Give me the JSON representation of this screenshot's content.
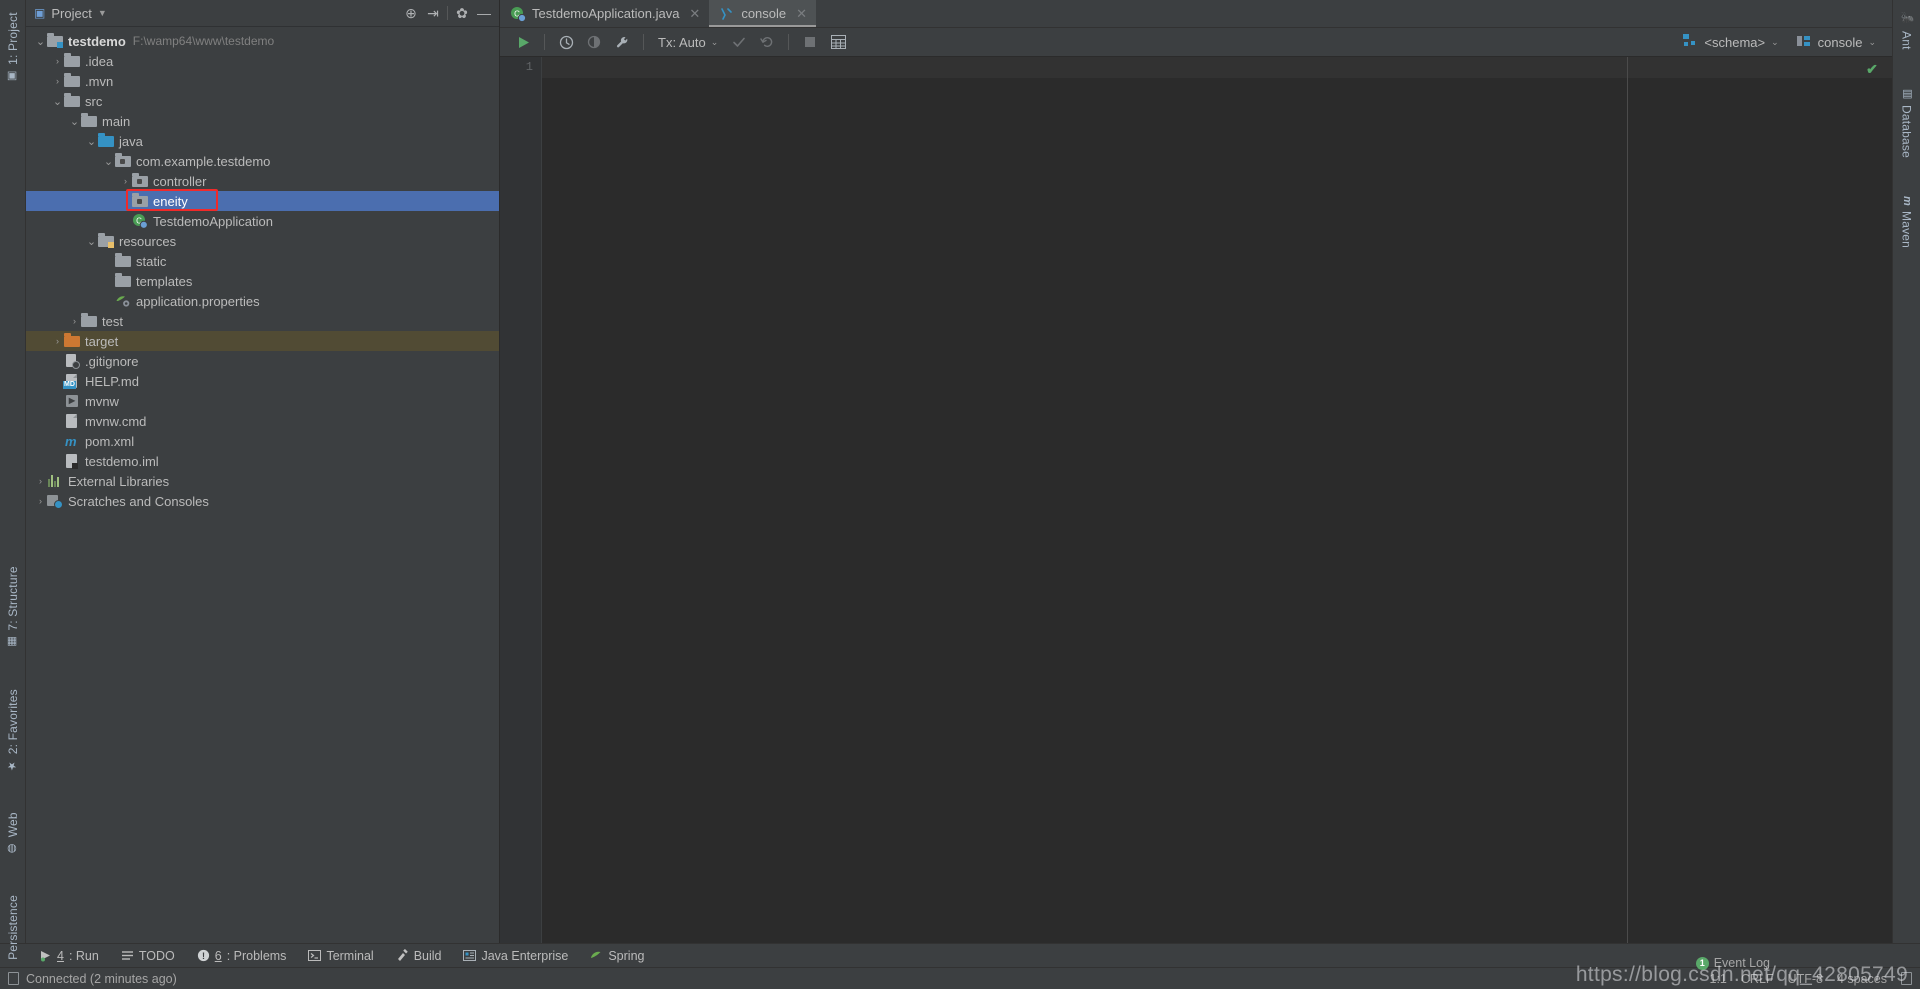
{
  "window": {
    "accent_blue": "#4b6eaf",
    "excluded_olive": "#514b34",
    "annotation_red": "#f02a2a"
  },
  "left_toolbar": {
    "items": [
      {
        "label": "1: Project",
        "icon": "project-icon"
      }
    ]
  },
  "left_sidebar_bottom": {
    "items": [
      {
        "label": "7: Structure",
        "icon": "structure-icon"
      },
      {
        "label": "2: Favorites",
        "icon": "star-icon"
      },
      {
        "label": "Web",
        "icon": "globe-icon"
      },
      {
        "label": "Persistence",
        "icon": "persistence-icon"
      }
    ]
  },
  "right_sidebar": {
    "items": [
      {
        "label": "Ant",
        "icon": "ant-icon"
      },
      {
        "label": "Database",
        "icon": "database-icon"
      },
      {
        "label": "Maven",
        "icon": "maven-icon"
      }
    ]
  },
  "project_panel": {
    "title": "Project",
    "title_chevron": "▼",
    "toolbar_icons": [
      {
        "name": "locate-icon",
        "glyph": "⊕"
      },
      {
        "name": "collapse-all-icon",
        "glyph": "⇥"
      },
      {
        "name": "gear-icon",
        "glyph": "✿"
      },
      {
        "name": "hide-icon",
        "glyph": "—"
      }
    ],
    "tree": [
      {
        "id": "testdemo",
        "label": "testdemo",
        "path": "F:\\wamp64\\www\\testdemo",
        "depth": 0,
        "arrow": "down",
        "icon": "module-folder",
        "bold": true
      },
      {
        "id": "idea",
        "label": ".idea",
        "depth": 1,
        "arrow": "right",
        "icon": "folder"
      },
      {
        "id": "mvn",
        "label": ".mvn",
        "depth": 1,
        "arrow": "right",
        "icon": "folder"
      },
      {
        "id": "src",
        "label": "src",
        "depth": 1,
        "arrow": "down",
        "icon": "folder"
      },
      {
        "id": "main",
        "label": "main",
        "depth": 2,
        "arrow": "down",
        "icon": "folder"
      },
      {
        "id": "java",
        "label": "java",
        "depth": 3,
        "arrow": "down",
        "icon": "source-folder"
      },
      {
        "id": "com.example.testdemo",
        "label": "com.example.testdemo",
        "depth": 4,
        "arrow": "down",
        "icon": "package"
      },
      {
        "id": "controller",
        "label": "controller",
        "depth": 5,
        "arrow": "right",
        "icon": "package"
      },
      {
        "id": "eneity",
        "label": "eneity",
        "depth": 5,
        "arrow": "none",
        "icon": "package",
        "selected": true,
        "annotated": true
      },
      {
        "id": "TestdemoApplication",
        "label": "TestdemoApplication",
        "depth": 5,
        "arrow": "none",
        "icon": "spring-class"
      },
      {
        "id": "resources",
        "label": "resources",
        "depth": 3,
        "arrow": "down",
        "icon": "resource-folder"
      },
      {
        "id": "static",
        "label": "static",
        "depth": 4,
        "arrow": "none",
        "icon": "folder"
      },
      {
        "id": "templates",
        "label": "templates",
        "depth": 4,
        "arrow": "none",
        "icon": "folder"
      },
      {
        "id": "application.properties",
        "label": "application.properties",
        "depth": 4,
        "arrow": "none",
        "icon": "spring-properties"
      },
      {
        "id": "test",
        "label": "test",
        "depth": 2,
        "arrow": "right",
        "icon": "folder"
      },
      {
        "id": "target",
        "label": "target",
        "depth": 1,
        "arrow": "right",
        "icon": "excluded-folder",
        "excluded": true
      },
      {
        "id": ".gitignore",
        "label": ".gitignore",
        "depth": 1,
        "arrow": "none",
        "icon": "gitignore-file"
      },
      {
        "id": "HELP.md",
        "label": "HELP.md",
        "depth": 1,
        "arrow": "none",
        "icon": "markdown-file"
      },
      {
        "id": "mvnw",
        "label": "mvnw",
        "depth": 1,
        "arrow": "none",
        "icon": "script-file"
      },
      {
        "id": "mvnw.cmd",
        "label": "mvnw.cmd",
        "depth": 1,
        "arrow": "none",
        "icon": "cmd-file"
      },
      {
        "id": "pom.xml",
        "label": "pom.xml",
        "depth": 1,
        "arrow": "none",
        "icon": "maven-pom-file"
      },
      {
        "id": "testdemo.iml",
        "label": "testdemo.iml",
        "depth": 1,
        "arrow": "none",
        "icon": "iml-file"
      },
      {
        "id": "External Libraries",
        "label": "External Libraries",
        "depth": 0,
        "arrow": "right",
        "icon": "libraries"
      },
      {
        "id": "Scratches and Consoles",
        "label": "Scratches and Consoles",
        "depth": 0,
        "arrow": "right",
        "icon": "scratches"
      }
    ]
  },
  "editor_tabs": [
    {
      "label": "TestdemoApplication.java",
      "icon": "spring-class-icon",
      "active": false,
      "close": "✕"
    },
    {
      "label": "console",
      "icon": "console-icon",
      "active": true,
      "close": "✕"
    }
  ],
  "db_toolbar": {
    "execute_label": "▶",
    "history_label": "🕑",
    "stats_label": "◑",
    "wrench_label": "🔧",
    "tx_label": "Tx: Auto",
    "tx_chevron": "⌄",
    "commit_label": "✓",
    "rollback_label": "↺",
    "stop_label": "■",
    "table_label": "▤",
    "schema_label": "<schema>",
    "schema_chevron": "⌄",
    "console_label": "console",
    "console_chevron": "⌄"
  },
  "console_editor": {
    "line_numbers": [
      "1"
    ],
    "content": "",
    "inspection_status": "✔"
  },
  "bottom_toolwindows": [
    {
      "label": "4: Run",
      "num": "4",
      "rest": ": Run",
      "icon": "run-icon"
    },
    {
      "label": "TODO",
      "icon": "todo-icon"
    },
    {
      "label": "6: Problems",
      "num": "6",
      "rest": ": Problems",
      "icon": "problems-icon"
    },
    {
      "label": "Terminal",
      "icon": "terminal-icon"
    },
    {
      "label": "Build",
      "icon": "build-icon"
    },
    {
      "label": "Java Enterprise",
      "icon": "java-enterprise-icon"
    },
    {
      "label": "Spring",
      "icon": "spring-icon"
    }
  ],
  "status_bar": {
    "message": "Connected (2 minutes ago)",
    "event_log": "Event Log",
    "event_count": "1",
    "caret_position": "1:1",
    "line_separator": "CRLF",
    "encoding": "UTF-8",
    "indent": "4 spaces"
  },
  "watermark": "https://blog.csdn.net/qq_42805749"
}
